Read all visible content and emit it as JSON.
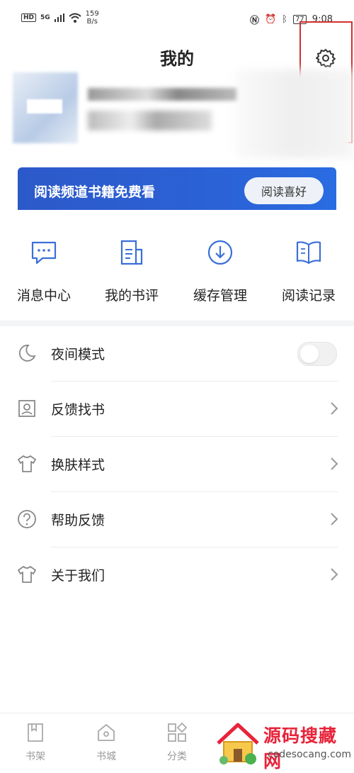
{
  "status_bar": {
    "hd": "HD",
    "signal": "5G",
    "net_speed": "159",
    "net_unit": "B/s",
    "battery": "77",
    "time": "9:08"
  },
  "header": {
    "title": "我的"
  },
  "banner": {
    "text": "阅读频道书籍免费看",
    "button": "阅读喜好"
  },
  "quick_actions": [
    {
      "label": "消息中心",
      "icon": "message-icon"
    },
    {
      "label": "我的书评",
      "icon": "book-review-icon"
    },
    {
      "label": "缓存管理",
      "icon": "download-icon"
    },
    {
      "label": "阅读记录",
      "icon": "open-book-icon"
    }
  ],
  "menu": [
    {
      "label": "夜间模式",
      "icon": "moon-icon"
    },
    {
      "label": "反馈找书",
      "icon": "search-book-icon"
    },
    {
      "label": "换肤样式",
      "icon": "shirt-icon"
    },
    {
      "label": "帮助反馈",
      "icon": "help-icon"
    },
    {
      "label": "关于我们",
      "icon": "shirt-icon"
    }
  ],
  "bottom_nav": [
    {
      "label": "书架",
      "icon": "bookshelf-icon"
    },
    {
      "label": "书城",
      "icon": "home-icon"
    },
    {
      "label": "分类",
      "icon": "category-icon"
    }
  ],
  "watermark": {
    "title": "源码搜藏网",
    "url": "codesocang.com"
  },
  "colors": {
    "banner_blue": "#2b5fd5",
    "accent_blue": "#3a6fd8",
    "highlight_red": "#d32f2f"
  }
}
